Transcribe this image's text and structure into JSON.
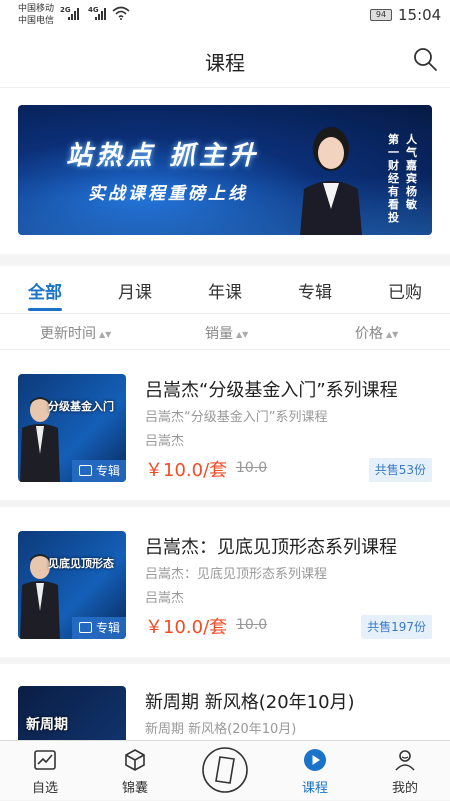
{
  "status_bar": {
    "carrier1": "中国移动",
    "carrier2": "中国电信",
    "net1": "2G",
    "net2": "4G",
    "battery": "94",
    "time": "15:04"
  },
  "header": {
    "title": "课程",
    "search_icon": "search-icon"
  },
  "banner": {
    "headline": "站热点 抓主升",
    "subline": "实战课程重磅上线",
    "vertical_col1": "人气嘉宾 杨敏",
    "vertical_col2": "第一财经有看投"
  },
  "tabs": [
    {
      "label": "全部",
      "active": true
    },
    {
      "label": "月课",
      "active": false
    },
    {
      "label": "年课",
      "active": false
    },
    {
      "label": "专辑",
      "active": false
    },
    {
      "label": "已购",
      "active": false
    }
  ],
  "sort": [
    {
      "label": "更新时间"
    },
    {
      "label": "销量"
    },
    {
      "label": "价格"
    }
  ],
  "courses": [
    {
      "title": "吕嵩杰“分级基金入门”系列课程",
      "subtitle": "吕嵩杰“分级基金入门”系列课程",
      "author": "吕嵩杰",
      "price": "￥10.0/套",
      "old_price": "10.0",
      "sold": "共售53份",
      "badge": "专辑",
      "thumb_text": "分级基金入门"
    },
    {
      "title": "吕嵩杰：见底见顶形态系列课程",
      "subtitle": "吕嵩杰：见底见顶形态系列课程",
      "author": "吕嵩杰",
      "price": "￥10.0/套",
      "old_price": "10.0",
      "sold": "共售197份",
      "badge": "专辑",
      "thumb_text": "见底见顶形态"
    },
    {
      "title": "新周期 新风格(20年10月)",
      "subtitle": "新周期 新风格(20年10月)",
      "thumb_text": "新周期"
    }
  ],
  "bottom_nav": [
    {
      "label": "自选",
      "icon": "chart-icon",
      "active": false
    },
    {
      "label": "锦囊",
      "icon": "box-icon",
      "active": false
    },
    {
      "label": "",
      "icon": "compass-icon",
      "active": false
    },
    {
      "label": "课程",
      "icon": "play-icon",
      "active": true
    },
    {
      "label": "我的",
      "icon": "user-icon",
      "active": false
    }
  ],
  "colors": {
    "accent": "#1a73c9",
    "price": "#f24c27",
    "sold_bg": "#e6f0fb"
  }
}
